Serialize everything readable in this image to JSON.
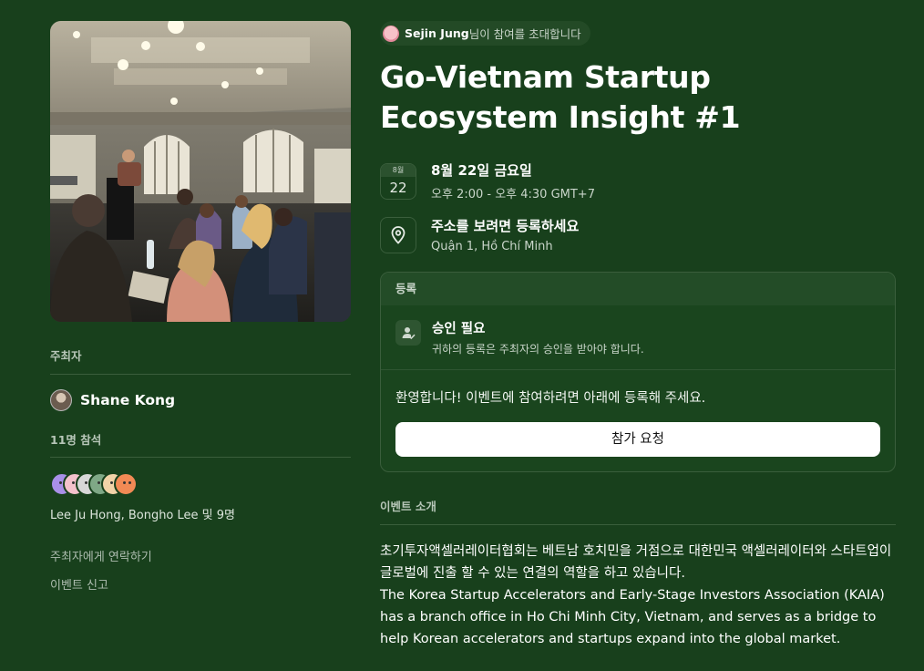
{
  "invite": {
    "name": "Sejin Jung",
    "message": "님이 참여를 초대합니다"
  },
  "event": {
    "title": "Go-Vietnam Startup Ecosystem Insight #1",
    "date_month": "8월",
    "date_day": "22",
    "date_main": "8월 22일 금요일",
    "time": "오후 2:00 - 오후 4:30 GMT+7",
    "location_main": "주소를 보려면 등록하세요",
    "location_sub": "Quận 1, Hồ Chí Minh"
  },
  "registration": {
    "header": "등록",
    "approval_title": "승인 필요",
    "approval_desc": "귀하의 등록은 주최자의 승인을 받아야 합니다.",
    "welcome": "환영합니다! 이벤트에 참여하려면 아래에 등록해 주세요.",
    "button_label": "참가 요청"
  },
  "sidebar": {
    "hosts_label": "주최자",
    "host_name": "Shane Kong",
    "attendees_label": "11명 참석",
    "attendee_names": "Lee Ju Hong, Bongho Lee 및 9명",
    "attendee_avatar_colors": [
      "#a990e8",
      "#f4c2cc",
      "#d8d8d8",
      "#7fa886",
      "#f2d3a8",
      "#f28a55"
    ],
    "contact_link": "주최자에게 연락하기",
    "report_link": "이벤트 신고"
  },
  "about": {
    "label": "이벤트 소개",
    "paragraph_ko": "초기투자액셀러레이터협회는 베트남 호치민을 거점으로 대한민국 액셀러레이터와 스타트업이 글로벌에 진출 할 수 있는 연결의 역할을 하고 있습니다.",
    "paragraph_en": "The Korea Startup Accelerators and Early-Stage Investors Association (KAIA) has a branch office in Ho Chi Minh City, Vietnam, and serves as a bridge to help Korean accelerators and startups expand into the global market."
  },
  "icons": {
    "location": "map-pin-icon",
    "approval": "user-check-icon"
  }
}
